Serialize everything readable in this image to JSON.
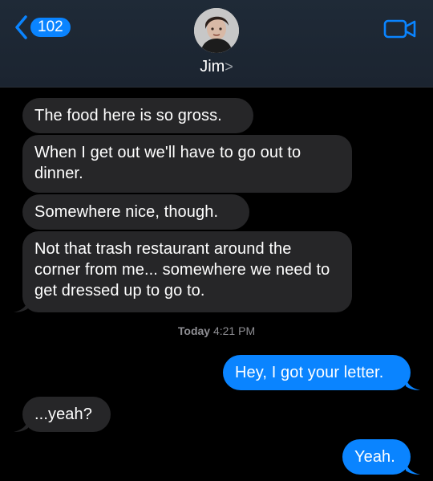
{
  "header": {
    "back_count": "102",
    "contact_name": "Jim",
    "name_chevron": ">"
  },
  "colors": {
    "accent": "#0a84ff",
    "incoming_bubble": "#262628",
    "background": "#000000"
  },
  "icons": {
    "back": "chevron-left-icon",
    "video": "video-camera-icon",
    "avatar": "contact-avatar"
  },
  "messages": [
    {
      "dir": "in",
      "text": "The food here is so gross."
    },
    {
      "dir": "in",
      "text": "When I get out we'll have to go out to dinner."
    },
    {
      "dir": "in",
      "text": "Somewhere nice, though."
    },
    {
      "dir": "in",
      "text": "Not that trash restaurant around the corner from me... somewhere we need to get dressed up to go to."
    },
    {
      "dir": "out",
      "text": "Hey, I got your letter."
    },
    {
      "dir": "in",
      "text": "...yeah?"
    },
    {
      "dir": "out",
      "text": "Yeah."
    }
  ],
  "timestamp": {
    "day": "Today",
    "time": "4:21 PM"
  }
}
